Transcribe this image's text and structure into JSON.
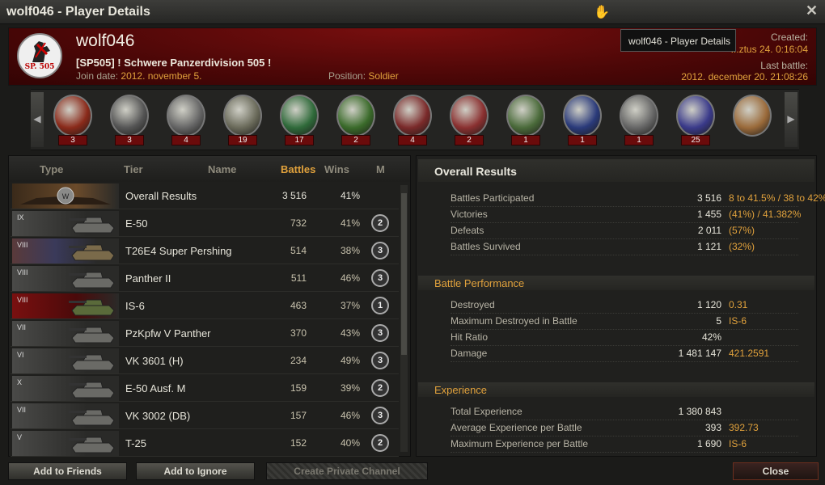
{
  "window": {
    "title": "wolf046 - Player Details"
  },
  "player": {
    "name": "wolf046",
    "clan": "[SP505] ! Schwere Panzerdivision 505 !",
    "logo_text": "SP. 505",
    "join_label": "Join date:",
    "join_value": "2012. november 5.",
    "position_label": "Position:",
    "position_value": "Soldier",
    "created_label": "Created:",
    "created_value": "...ztus 24. 0:16:04",
    "last_battle_label": "Last battle:",
    "last_battle_value": "2012. december 20. 21:08:26"
  },
  "tooltip": "wolf046 - Player Details",
  "medals": [
    {
      "icon": "medal-icon-red-star",
      "count": "3",
      "color": "#8a2a1a"
    },
    {
      "icon": "medal-icon-tank-wreath",
      "count": "3",
      "color": "#555"
    },
    {
      "icon": "medal-icon-tank-wings",
      "count": "4",
      "color": "#666"
    },
    {
      "icon": "medal-icon-tank-shield",
      "count": "19",
      "color": "#6a6a5a"
    },
    {
      "icon": "medal-icon-green-ribbon",
      "count": "17",
      "color": "#2f6a3a"
    },
    {
      "icon": "medal-icon-green-ribbon-2",
      "count": "2",
      "color": "#3a6a2a"
    },
    {
      "icon": "medal-icon-red-sword",
      "count": "4",
      "color": "#7a2a2a"
    },
    {
      "icon": "medal-icon-red-glyph",
      "count": "2",
      "color": "#8a3030"
    },
    {
      "icon": "medal-icon-clover-tank",
      "count": "1",
      "color": "#4a6a3a"
    },
    {
      "icon": "medal-icon-blue-lion",
      "count": "1",
      "color": "#2a3a7a"
    },
    {
      "icon": "medal-icon-silver-tank",
      "count": "1",
      "color": "#666"
    },
    {
      "icon": "medal-icon-blue-bird",
      "count": "25",
      "color": "#3a3a8a"
    },
    {
      "icon": "medal-icon-portrait",
      "count": "",
      "color": "#9a6a3a"
    }
  ],
  "table": {
    "headers": {
      "type": "Type",
      "tier": "Tier",
      "name": "Name",
      "battles": "Battles",
      "wins": "Wins",
      "mastery": "M"
    },
    "overall": {
      "name": "Overall Results",
      "battles": "3 516",
      "wins": "41%"
    },
    "rows": [
      {
        "tier": "IX",
        "name": "E-50",
        "battles": "732",
        "wins": "41%",
        "mastery": "2",
        "nation": "germany"
      },
      {
        "tier": "VIII",
        "name": "T26E4 Super Pershing",
        "battles": "514",
        "wins": "38%",
        "mastery": "3",
        "nation": "usa"
      },
      {
        "tier": "VIII",
        "name": "Panther II",
        "battles": "511",
        "wins": "46%",
        "mastery": "3",
        "nation": "germany"
      },
      {
        "tier": "VIII",
        "name": "IS-6",
        "battles": "463",
        "wins": "37%",
        "mastery": "1",
        "nation": "ussr"
      },
      {
        "tier": "VII",
        "name": "PzKpfw V Panther",
        "battles": "370",
        "wins": "43%",
        "mastery": "3",
        "nation": "germany"
      },
      {
        "tier": "VI",
        "name": "VK 3601 (H)",
        "battles": "234",
        "wins": "49%",
        "mastery": "3",
        "nation": "germany"
      },
      {
        "tier": "X",
        "name": "E-50 Ausf. M",
        "battles": "159",
        "wins": "39%",
        "mastery": "2",
        "nation": "germany"
      },
      {
        "tier": "VII",
        "name": "VK 3002 (DB)",
        "battles": "157",
        "wins": "46%",
        "mastery": "3",
        "nation": "germany"
      },
      {
        "tier": "V",
        "name": "T-25",
        "battles": "152",
        "wins": "40%",
        "mastery": "2",
        "nation": "germany"
      }
    ]
  },
  "stats": {
    "overall_title": "Overall Results",
    "overall": [
      {
        "label": "Battles Participated",
        "value": "3 516",
        "extra": "8 to 41.5% / 38 to 42%"
      },
      {
        "label": "Victories",
        "value": "1 455",
        "extra": "(41%)  /  41.382%"
      },
      {
        "label": "Defeats",
        "value": "2 011",
        "extra": "(57%)"
      },
      {
        "label": "Battles Survived",
        "value": "1 121",
        "extra": "(32%)"
      }
    ],
    "performance_title": "Battle Performance",
    "performance": [
      {
        "label": "Destroyed",
        "value": "1 120",
        "extra": "0.31"
      },
      {
        "label": "Maximum Destroyed in Battle",
        "value": "5",
        "extra": "IS-6"
      },
      {
        "label": "Hit Ratio",
        "value": "42%",
        "extra": ""
      },
      {
        "label": "Damage",
        "value": "1 481 147",
        "extra": "421.2591"
      }
    ],
    "experience_title": "Experience",
    "experience": [
      {
        "label": "Total Experience",
        "value": "1 380 843",
        "extra": ""
      },
      {
        "label": "Average Experience per Battle",
        "value": "393",
        "extra": "392.73"
      },
      {
        "label": "Maximum Experience per Battle",
        "value": "1 690",
        "extra": "IS-6"
      }
    ]
  },
  "buttons": {
    "add_friends": "Add to Friends",
    "add_ignore": "Add to Ignore",
    "private_channel": "Create Private Channel",
    "close": "Close"
  },
  "colors": {
    "accent": "#e0a13c",
    "header_red": "#5a0909"
  }
}
